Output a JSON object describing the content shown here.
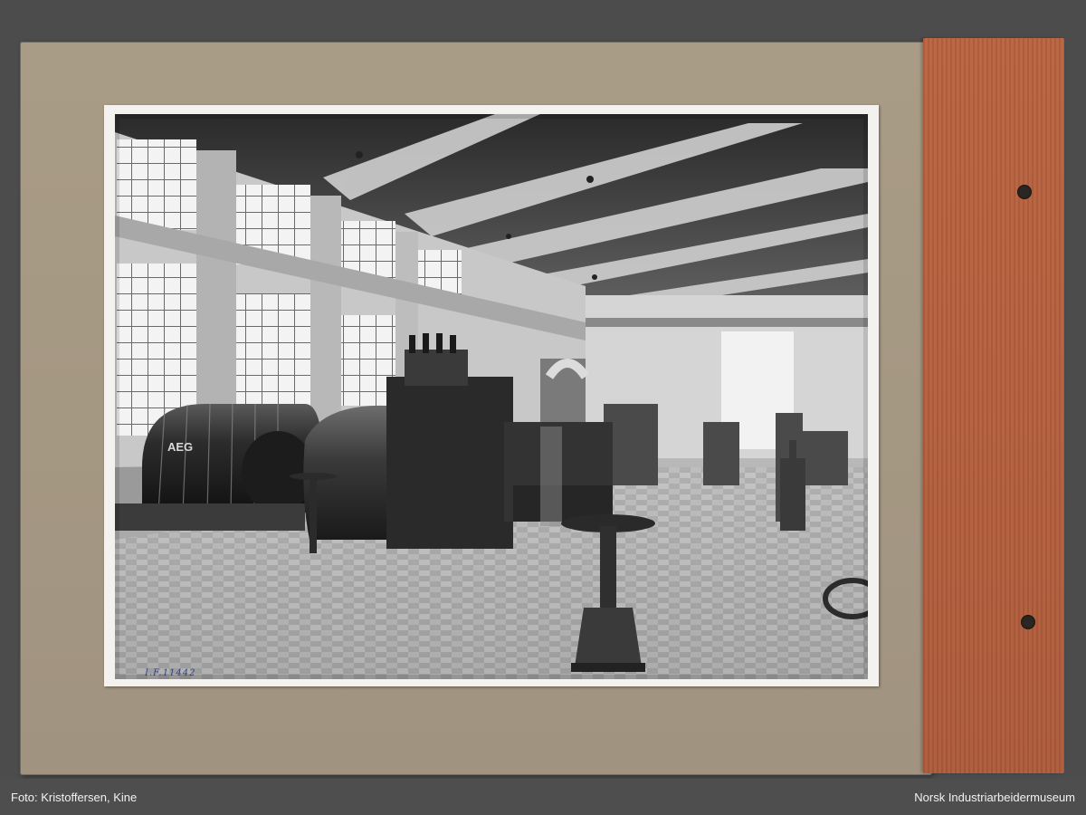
{
  "photo": {
    "inventory_number": "I.F.11442",
    "machine_marking": "AEG"
  },
  "footer": {
    "credit": "Foto: Kristoffersen, Kine",
    "museum": "Norsk Industriarbeidermuseum"
  },
  "colors": {
    "viewer_background": "#4c4c4c",
    "board": "#a59883",
    "spine": "#b45f3d",
    "photo_border": "#f4f2ee",
    "ink": "#2f3f8a"
  }
}
